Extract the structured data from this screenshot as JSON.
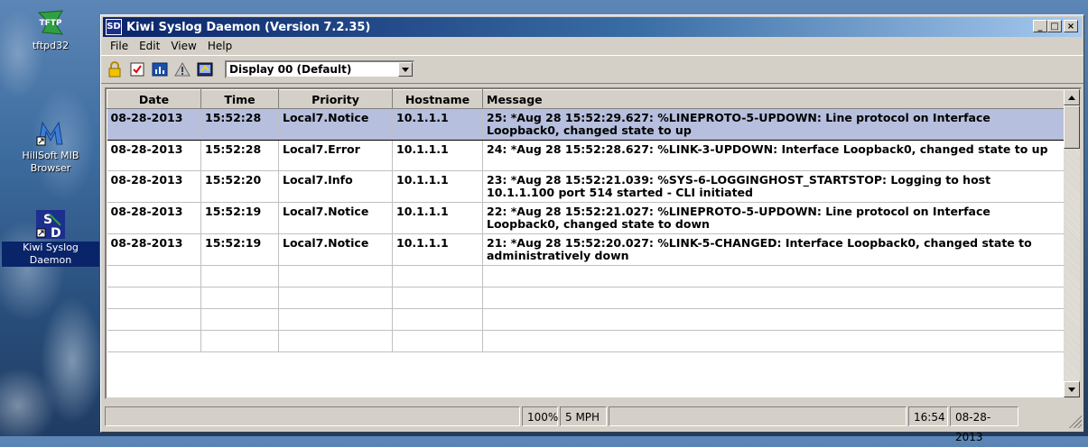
{
  "desktop": {
    "icons": [
      {
        "label": "tftpd32",
        "icon": "tftp-icon"
      },
      {
        "label": "HillSoft MIB Browser",
        "icon": "mib-browser-icon"
      },
      {
        "label": "Kiwi Syslog Daemon",
        "icon": "kiwi-syslog-icon"
      }
    ]
  },
  "window": {
    "title": "Kiwi Syslog Daemon (Version 7.2.35)",
    "controls": [
      "_",
      "□",
      "×"
    ]
  },
  "menu": [
    "File",
    "Edit",
    "View",
    "Help"
  ],
  "toolbar": {
    "icons": [
      "lock-icon",
      "checkbox-icon",
      "chart-icon",
      "warning-icon",
      "display-icon"
    ],
    "display_select": "Display 00 (Default)"
  },
  "table": {
    "columns": [
      "Date",
      "Time",
      "Priority",
      "Hostname",
      "Message"
    ],
    "rows": [
      {
        "date": "08-28-2013",
        "time": "15:52:28",
        "priority": "Local7.Notice",
        "host": "10.1.1.1",
        "message": "25: *Aug 28 15:52:29.627: %LINEPROTO-5-UPDOWN: Line protocol on Interface Loopback0, changed state to up",
        "selected": true
      },
      {
        "date": "08-28-2013",
        "time": "15:52:28",
        "priority": "Local7.Error",
        "host": "10.1.1.1",
        "message": "24: *Aug 28 15:52:28.627: %LINK-3-UPDOWN: Interface Loopback0, changed state to up",
        "selected": false
      },
      {
        "date": "08-28-2013",
        "time": "15:52:20",
        "priority": "Local7.Info",
        "host": "10.1.1.1",
        "message": "23: *Aug 28 15:52:21.039: %SYS-6-LOGGINGHOST_STARTSTOP: Logging to host 10.1.1.100 port 514 started - CLI initiated",
        "selected": false
      },
      {
        "date": "08-28-2013",
        "time": "15:52:19",
        "priority": "Local7.Notice",
        "host": "10.1.1.1",
        "message": "22: *Aug 28 15:52:21.027: %LINEPROTO-5-UPDOWN: Line protocol on Interface Loopback0, changed state to down",
        "selected": false
      },
      {
        "date": "08-28-2013",
        "time": "15:52:19",
        "priority": "Local7.Notice",
        "host": "10.1.1.1",
        "message": "21: *Aug 28 15:52:20.027: %LINK-5-CHANGED: Interface Loopback0, changed state to administratively down",
        "selected": false
      }
    ]
  },
  "status": {
    "zoom": "100%",
    "speed": "5 MPH",
    "time": "16:54",
    "date": "08-28-2013"
  }
}
